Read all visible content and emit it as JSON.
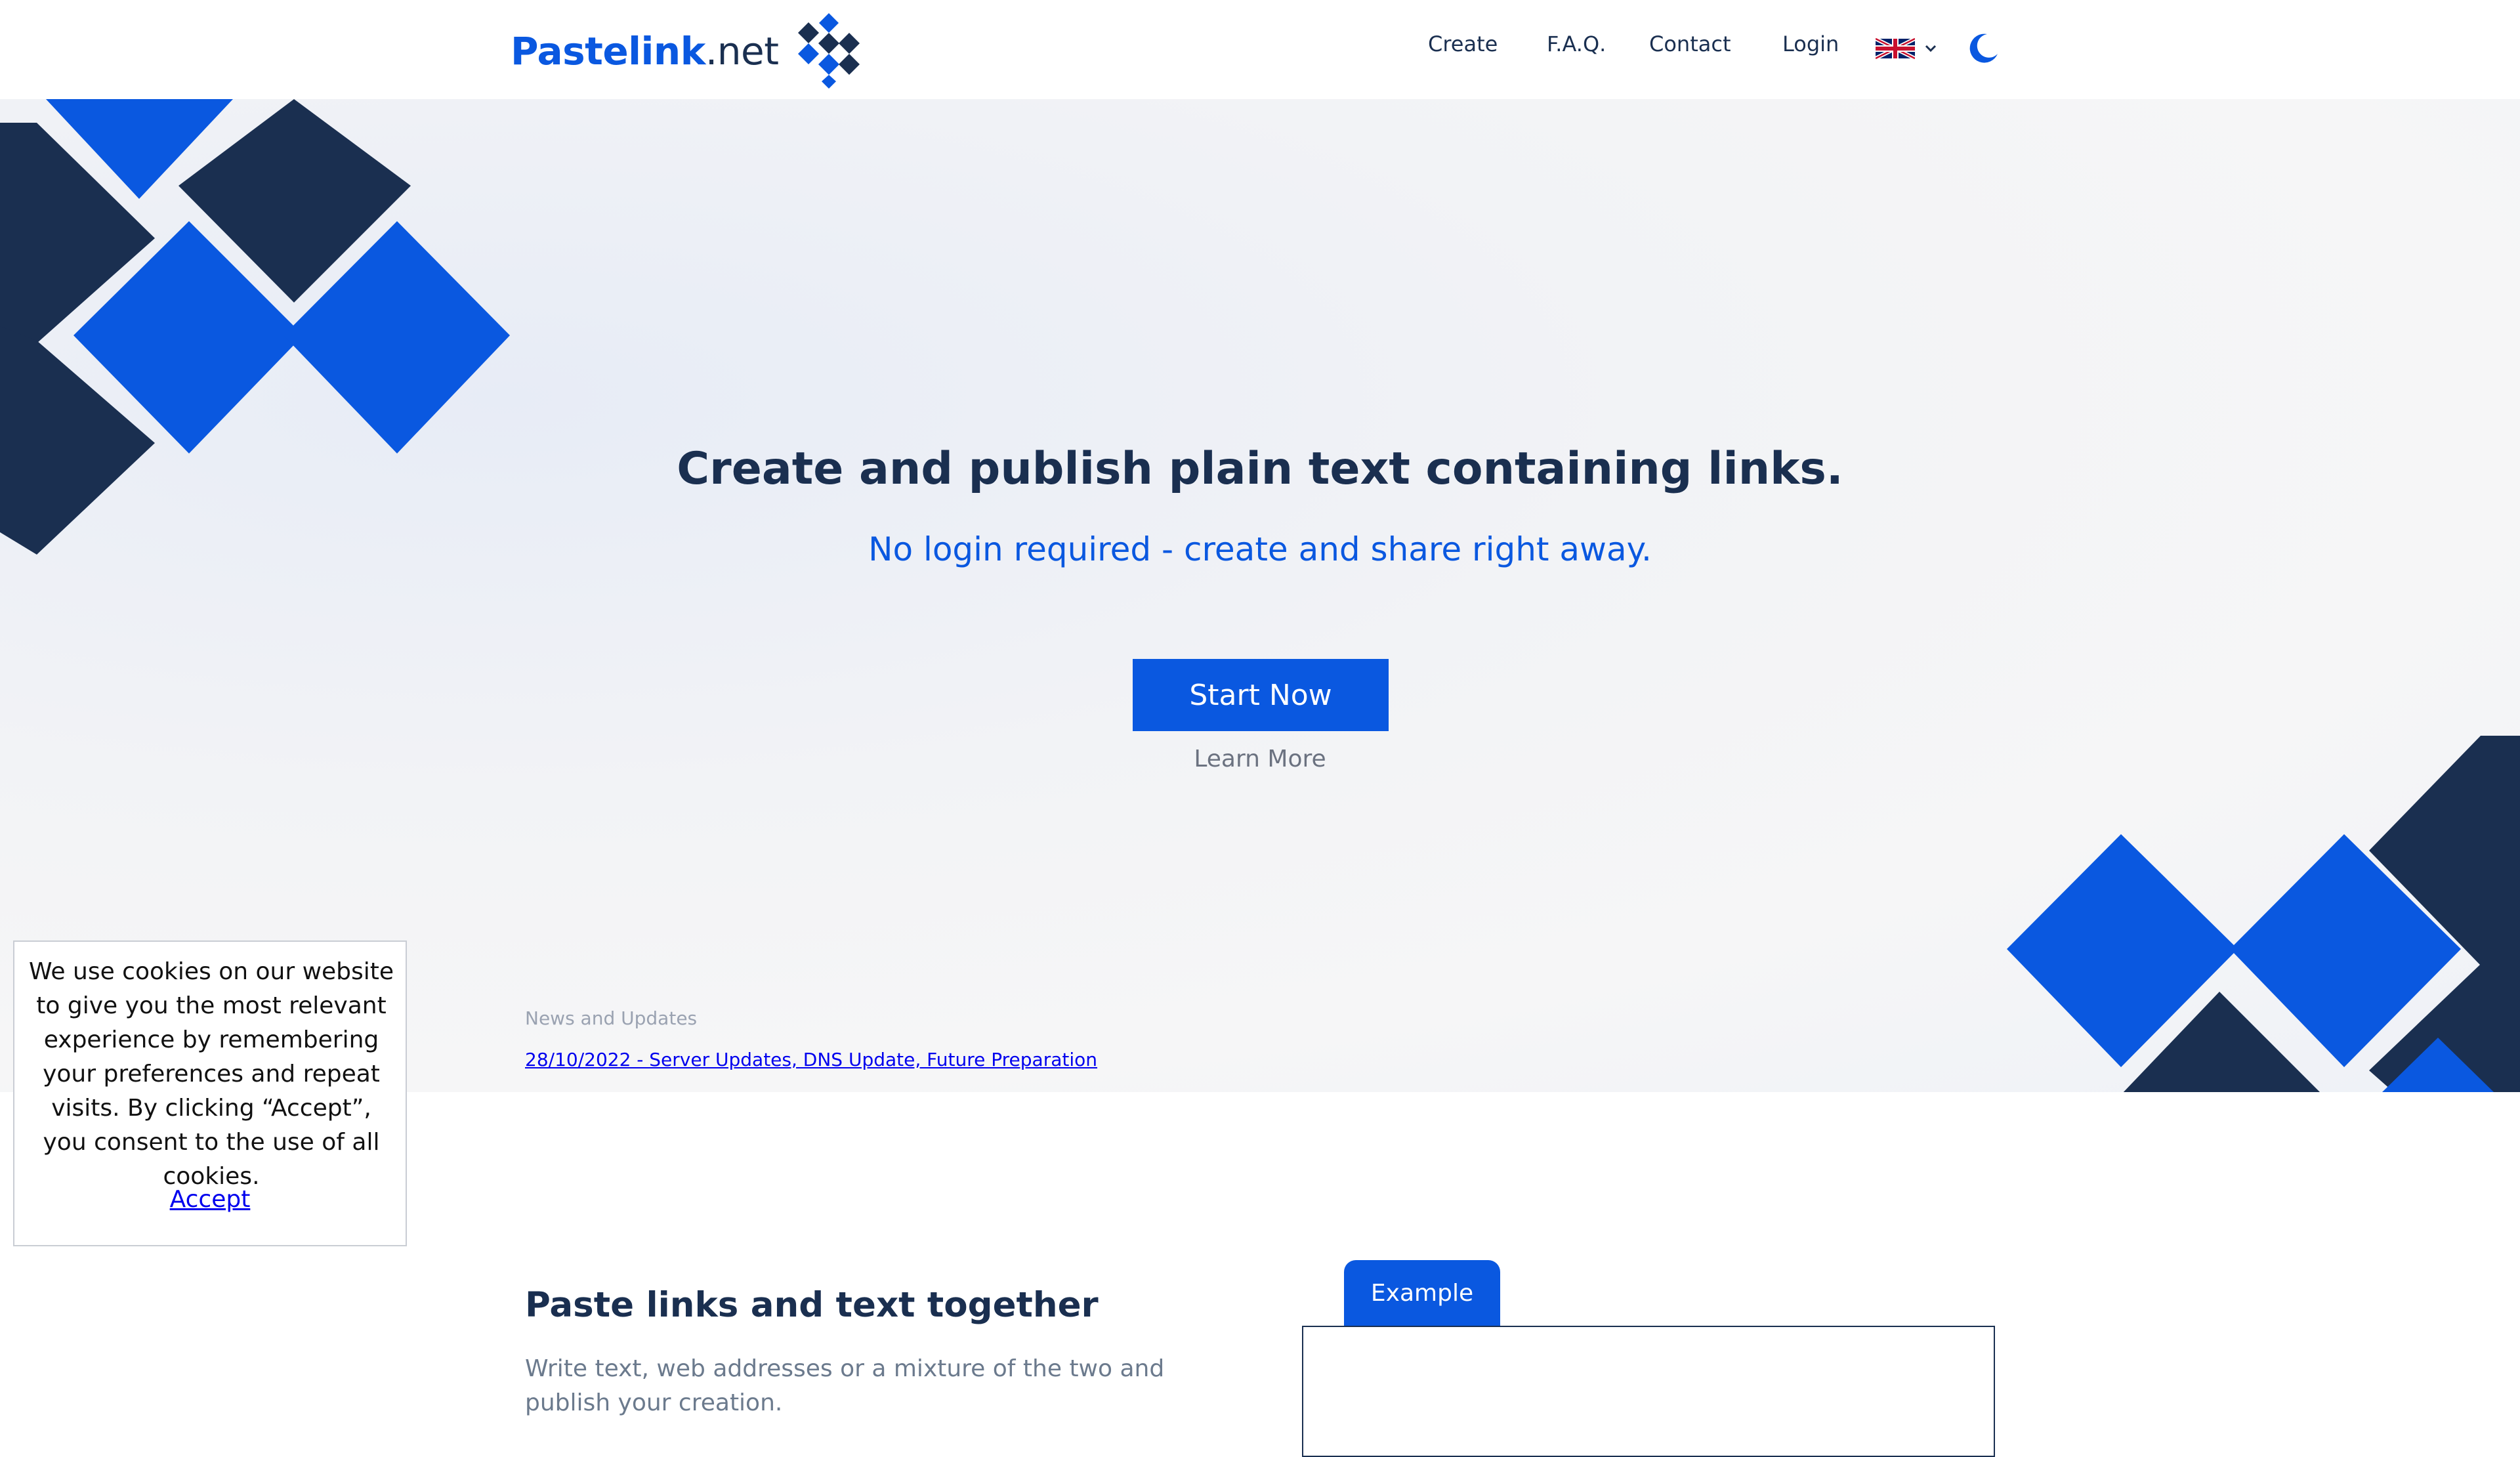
{
  "header": {
    "logo": {
      "bold": "Pastelink",
      "suffix": ".net"
    },
    "nav": [
      {
        "label": "Create"
      },
      {
        "label": "F.A.Q."
      },
      {
        "label": "Contact"
      },
      {
        "label": "Login"
      }
    ],
    "language_icon": "uk-flag-icon",
    "theme_icon": "moon-icon"
  },
  "hero": {
    "title": "Create and publish plain text containing links.",
    "subtitle": "No login required - create and share right away.",
    "start_label": "Start Now",
    "learn_label": "Learn More",
    "news_title": "News and Updates",
    "news_link": "28/10/2022 - Server Updates, DNS Update, Future Preparation"
  },
  "cookie": {
    "text": "We use cookies on our website to give you the most relevant experience by remembering your preferences and repeat visits. By clicking “Accept”, you consent to the use of all cookies.",
    "accept_label": "Accept"
  },
  "section": {
    "title": "Paste links and text together",
    "description": "Write text, web addresses or a mixture of the two and publish your creation.",
    "example_tab": "Example"
  },
  "colors": {
    "brand_blue": "#0a58e0",
    "navy": "#1a2f50",
    "hero_bg": "#f4f5f7"
  }
}
